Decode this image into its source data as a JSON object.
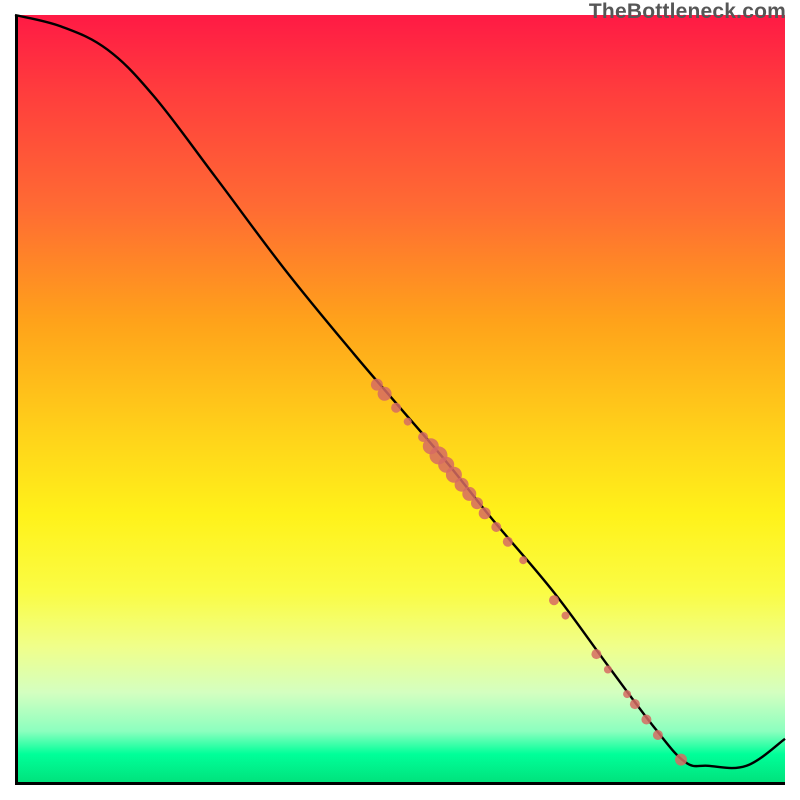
{
  "watermark": "TheBottleneck.com",
  "colors": {
    "curve": "#000000",
    "marker_fill": "#d66b63",
    "marker_stroke": "#b84d49",
    "axis": "#000000"
  },
  "chart_data": {
    "type": "line",
    "title": "",
    "xlabel": "",
    "ylabel": "",
    "xlim": [
      0,
      100
    ],
    "ylim": [
      0,
      100
    ],
    "curve": [
      {
        "x": 0,
        "y": 100
      },
      {
        "x": 6,
        "y": 98.5
      },
      {
        "x": 12,
        "y": 95.5
      },
      {
        "x": 18,
        "y": 89.5
      },
      {
        "x": 26,
        "y": 79
      },
      {
        "x": 35,
        "y": 67
      },
      {
        "x": 44,
        "y": 56
      },
      {
        "x": 50,
        "y": 49
      },
      {
        "x": 56,
        "y": 42
      },
      {
        "x": 62,
        "y": 34.5
      },
      {
        "x": 70,
        "y": 25
      },
      {
        "x": 77,
        "y": 15.5
      },
      {
        "x": 83,
        "y": 7.5
      },
      {
        "x": 87,
        "y": 3
      },
      {
        "x": 90,
        "y": 2.5
      },
      {
        "x": 95,
        "y": 2.5
      },
      {
        "x": 100,
        "y": 6
      }
    ],
    "series": [
      {
        "name": "markers",
        "points": [
          {
            "x": 47,
            "y": 52,
            "r": 6
          },
          {
            "x": 48,
            "y": 50.8,
            "r": 7
          },
          {
            "x": 49.5,
            "y": 49.0,
            "r": 5
          },
          {
            "x": 51,
            "y": 47.2,
            "r": 4
          },
          {
            "x": 53,
            "y": 45.2,
            "r": 5
          },
          {
            "x": 54,
            "y": 44,
            "r": 8
          },
          {
            "x": 55,
            "y": 42.8,
            "r": 9
          },
          {
            "x": 56,
            "y": 41.6,
            "r": 8
          },
          {
            "x": 57,
            "y": 40.3,
            "r": 8
          },
          {
            "x": 58,
            "y": 39,
            "r": 7
          },
          {
            "x": 59,
            "y": 37.8,
            "r": 7
          },
          {
            "x": 60,
            "y": 36.6,
            "r": 6
          },
          {
            "x": 61,
            "y": 35.3,
            "r": 6
          },
          {
            "x": 62.5,
            "y": 33.5,
            "r": 5
          },
          {
            "x": 64,
            "y": 31.6,
            "r": 5
          },
          {
            "x": 66,
            "y": 29.2,
            "r": 4
          },
          {
            "x": 70,
            "y": 24,
            "r": 5
          },
          {
            "x": 71.5,
            "y": 22,
            "r": 4
          },
          {
            "x": 75.5,
            "y": 17,
            "r": 5
          },
          {
            "x": 77,
            "y": 15,
            "r": 4
          },
          {
            "x": 79.5,
            "y": 11.8,
            "r": 4
          },
          {
            "x": 80.5,
            "y": 10.5,
            "r": 5
          },
          {
            "x": 82,
            "y": 8.5,
            "r": 5
          },
          {
            "x": 83.5,
            "y": 6.5,
            "r": 5
          },
          {
            "x": 86.5,
            "y": 3.3,
            "r": 6
          }
        ]
      }
    ]
  }
}
